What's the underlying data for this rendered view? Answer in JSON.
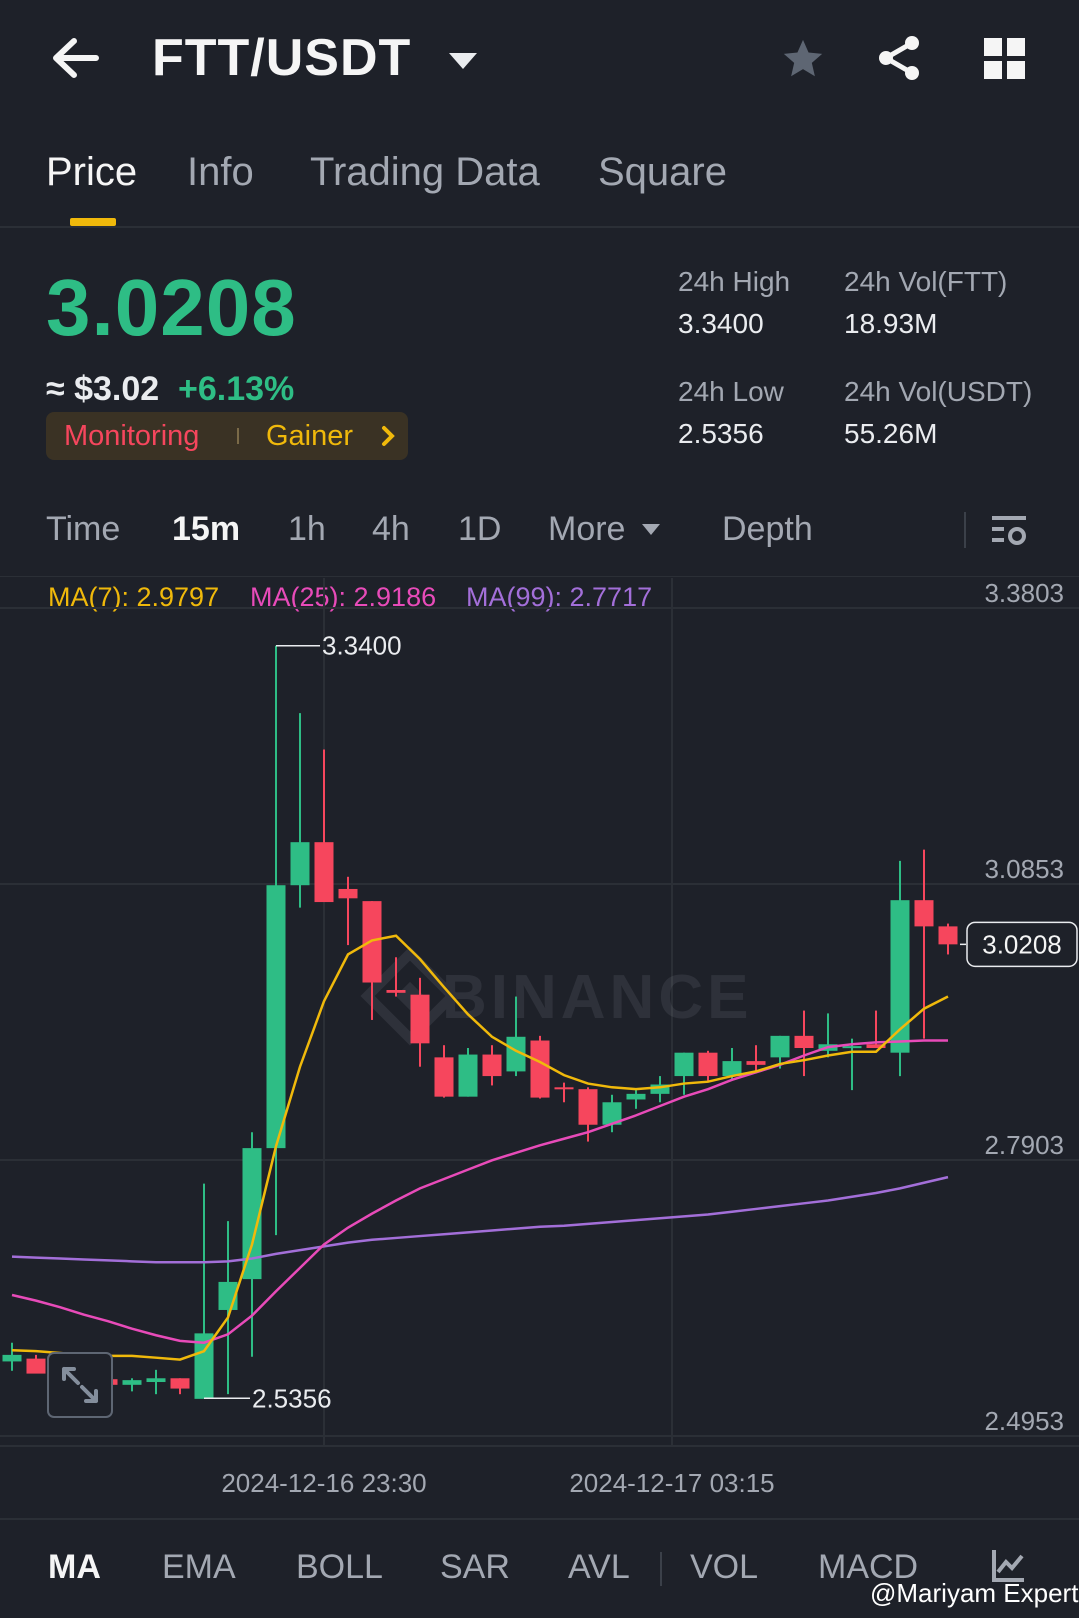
{
  "header": {
    "pair": "FTT/USDT",
    "icons": [
      "back-arrow-icon",
      "caret-down-icon",
      "star-icon",
      "share-icon",
      "grid-icon"
    ]
  },
  "tabs": [
    {
      "label": "Price",
      "active": true
    },
    {
      "label": "Info",
      "active": false
    },
    {
      "label": "Trading Data",
      "active": false
    },
    {
      "label": "Square",
      "active": false
    }
  ],
  "ticker": {
    "last_price": "3.0208",
    "usd_value": "≈ $3.02",
    "change_pct": "+6.13%",
    "tag_monitoring": "Monitoring",
    "tag_gainer": "Gainer",
    "stats": {
      "high_label": "24h High",
      "high_value": "3.3400",
      "low_label": "24h Low",
      "low_value": "2.5356",
      "vol_ftt_label": "24h Vol(FTT)",
      "vol_ftt_value": "18.93M",
      "vol_usdt_label": "24h Vol(USDT)",
      "vol_usdt_value": "55.26M"
    }
  },
  "intervals": [
    {
      "label": "Time",
      "active": false
    },
    {
      "label": "15m",
      "active": true
    },
    {
      "label": "1h",
      "active": false
    },
    {
      "label": "4h",
      "active": false
    },
    {
      "label": "1D",
      "active": false
    },
    {
      "label": "More",
      "active": false
    },
    {
      "label": "Depth",
      "active": false
    }
  ],
  "ma_legend": {
    "ma7": "MA(7): 2.9797",
    "ma25": "MA(25): 2.9186",
    "ma99": "MA(99): 2.7717"
  },
  "colors": {
    "up": "#2ebd85",
    "down": "#f6465d",
    "ma7": "#f0b90b",
    "ma25": "#e84bb9",
    "ma99": "#a36fd9",
    "accent": "#f0b90b"
  },
  "watermark": "BINANCE",
  "credit": "@Mariyam Expert",
  "chart_data": {
    "type": "candlestick",
    "interval": "15m",
    "y_ticks": [
      "3.3803",
      "3.0853",
      "2.7903",
      "2.4953"
    ],
    "ylim": [
      2.4953,
      3.3803
    ],
    "x_ticks": [
      "2024-12-16 23:30",
      "2024-12-17 03:15"
    ],
    "high_marker": "3.3400",
    "low_marker": "2.5356",
    "last_price_label": "3.0208",
    "candles": [
      {
        "o": 2.575,
        "h": 2.595,
        "l": 2.565,
        "c": 2.582
      },
      {
        "o": 2.578,
        "h": 2.582,
        "l": 2.565,
        "c": 2.562
      },
      {
        "o": 2.566,
        "h": 2.566,
        "l": 2.553,
        "c": 2.56
      },
      {
        "o": 2.559,
        "h": 2.562,
        "l": 2.55,
        "c": 2.556
      },
      {
        "o": 2.556,
        "h": 2.56,
        "l": 2.545,
        "c": 2.55
      },
      {
        "o": 2.55,
        "h": 2.557,
        "l": 2.543,
        "c": 2.555
      },
      {
        "o": 2.553,
        "h": 2.566,
        "l": 2.54,
        "c": 2.557
      },
      {
        "o": 2.557,
        "h": 2.557,
        "l": 2.54,
        "c": 2.546
      },
      {
        "o": 2.535,
        "h": 2.765,
        "l": 2.5356,
        "c": 2.605
      },
      {
        "o": 2.63,
        "h": 2.725,
        "l": 2.54,
        "c": 2.66
      },
      {
        "o": 2.663,
        "h": 2.82,
        "l": 2.58,
        "c": 2.803
      },
      {
        "o": 2.803,
        "h": 3.34,
        "l": 2.71,
        "c": 3.084
      },
      {
        "o": 3.084,
        "h": 3.268,
        "l": 3.06,
        "c": 3.13
      },
      {
        "o": 3.13,
        "h": 3.229,
        "l": 3.07,
        "c": 3.066
      },
      {
        "o": 3.08,
        "h": 3.093,
        "l": 3.02,
        "c": 3.07
      },
      {
        "o": 3.067,
        "h": 3.067,
        "l": 2.94,
        "c": 2.98
      },
      {
        "o": 2.972,
        "h": 3.007,
        "l": 2.965,
        "c": 2.969
      },
      {
        "o": 2.967,
        "h": 2.985,
        "l": 2.89,
        "c": 2.915
      },
      {
        "o": 2.9,
        "h": 2.913,
        "l": 2.857,
        "c": 2.858
      },
      {
        "o": 2.858,
        "h": 2.91,
        "l": 2.858,
        "c": 2.903
      },
      {
        "o": 2.903,
        "h": 2.913,
        "l": 2.87,
        "c": 2.88
      },
      {
        "o": 2.885,
        "h": 2.965,
        "l": 2.88,
        "c": 2.922
      },
      {
        "o": 2.918,
        "h": 2.923,
        "l": 2.856,
        "c": 2.857
      },
      {
        "o": 2.868,
        "h": 2.873,
        "l": 2.852,
        "c": 2.866
      },
      {
        "o": 2.866,
        "h": 2.868,
        "l": 2.81,
        "c": 2.828
      },
      {
        "o": 2.828,
        "h": 2.86,
        "l": 2.82,
        "c": 2.852
      },
      {
        "o": 2.855,
        "h": 2.865,
        "l": 2.845,
        "c": 2.861
      },
      {
        "o": 2.861,
        "h": 2.88,
        "l": 2.852,
        "c": 2.871
      },
      {
        "o": 2.88,
        "h": 2.905,
        "l": 2.86,
        "c": 2.905
      },
      {
        "o": 2.905,
        "h": 2.907,
        "l": 2.875,
        "c": 2.88
      },
      {
        "o": 2.88,
        "h": 2.91,
        "l": 2.875,
        "c": 2.896
      },
      {
        "o": 2.896,
        "h": 2.913,
        "l": 2.883,
        "c": 2.892
      },
      {
        "o": 2.9,
        "h": 2.923,
        "l": 2.888,
        "c": 2.923
      },
      {
        "o": 2.923,
        "h": 2.95,
        "l": 2.88,
        "c": 2.91
      },
      {
        "o": 2.907,
        "h": 2.947,
        "l": 2.9,
        "c": 2.914
      },
      {
        "o": 2.912,
        "h": 2.92,
        "l": 2.865,
        "c": 2.912
      },
      {
        "o": 2.914,
        "h": 2.95,
        "l": 2.91,
        "c": 2.91
      },
      {
        "o": 2.905,
        "h": 3.11,
        "l": 2.88,
        "c": 3.068
      },
      {
        "o": 3.068,
        "h": 3.122,
        "l": 2.92,
        "c": 3.04
      },
      {
        "o": 3.04,
        "h": 3.043,
        "l": 3.01,
        "c": 3.0208
      }
    ],
    "ma7": [
      2.587,
      2.586,
      2.584,
      2.582,
      2.581,
      2.581,
      2.579,
      2.577,
      2.586,
      2.622,
      2.7,
      2.805,
      2.89,
      2.96,
      3.01,
      3.025,
      3.03,
      3.005,
      2.975,
      2.946,
      2.922,
      2.907,
      2.895,
      2.881,
      2.872,
      2.868,
      2.866,
      2.868,
      2.872,
      2.874,
      2.88,
      2.885,
      2.893,
      2.897,
      2.902,
      2.906,
      2.906,
      2.93,
      2.952,
      2.965
    ],
    "ma25": [
      2.646,
      2.64,
      2.633,
      2.625,
      2.618,
      2.61,
      2.603,
      2.597,
      2.595,
      2.604,
      2.624,
      2.65,
      2.675,
      2.7,
      2.718,
      2.733,
      2.747,
      2.76,
      2.77,
      2.78,
      2.79,
      2.798,
      2.806,
      2.813,
      2.82,
      2.829,
      2.838,
      2.848,
      2.858,
      2.866,
      2.876,
      2.884,
      2.892,
      2.902,
      2.911,
      2.914,
      2.916,
      2.917,
      2.918,
      2.918
    ],
    "ma99": [
      2.687,
      2.686,
      2.685,
      2.684,
      2.683,
      2.682,
      2.681,
      2.681,
      2.681,
      2.682,
      2.685,
      2.69,
      2.694,
      2.698,
      2.702,
      2.705,
      2.707,
      2.709,
      2.711,
      2.713,
      2.715,
      2.717,
      2.719,
      2.72,
      2.722,
      2.724,
      2.726,
      2.728,
      2.73,
      2.732,
      2.735,
      2.738,
      2.741,
      2.744,
      2.747,
      2.751,
      2.755,
      2.76,
      2.766,
      2.772
    ]
  },
  "indicators": [
    {
      "label": "MA",
      "active": true
    },
    {
      "label": "EMA",
      "active": false
    },
    {
      "label": "BOLL",
      "active": false
    },
    {
      "label": "SAR",
      "active": false
    },
    {
      "label": "AVL",
      "active": false
    },
    {
      "label": "VOL",
      "active": false
    },
    {
      "label": "MACD",
      "active": false
    }
  ]
}
